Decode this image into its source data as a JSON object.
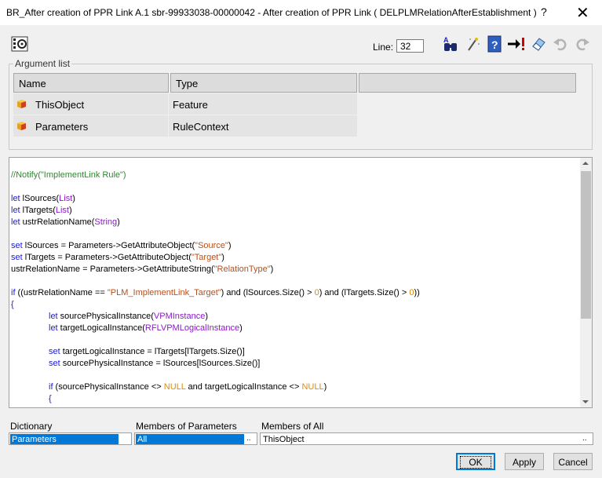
{
  "window": {
    "title": "BR_After creation of PPR Link A.1 sbr-99933038-00000042 - After creation of PPR Link   ( DELPLMRelationAfterEstablishment )",
    "help": "?",
    "close": "✕"
  },
  "toolbar": {
    "line_label": "Line:",
    "line_value": "32"
  },
  "arguments": {
    "group_label": "Argument list",
    "headers": [
      "Name",
      "Type"
    ],
    "rows": [
      {
        "name": "ThisObject",
        "type": "Feature"
      },
      {
        "name": "Parameters",
        "type": "RuleContext"
      }
    ]
  },
  "editor": {
    "lines": [
      {
        "text": "//Notify(\"ImplementLink Rule\")"
      },
      {
        "text": ""
      },
      {
        "text": "let lSources(List)"
      },
      {
        "text": "let lTargets(List)"
      },
      {
        "text": "let ustrRelationName(String)"
      },
      {
        "text": ""
      },
      {
        "text": "set lSources = Parameters->GetAttributeObject(\"Source\")"
      },
      {
        "text": "set lTargets = Parameters->GetAttributeObject(\"Target\")"
      },
      {
        "text": "ustrRelationName = Parameters->GetAttributeString(\"RelationType\")"
      },
      {
        "text": ""
      },
      {
        "text": "if ((ustrRelationName == \"PLM_ImplementLink_Target\") and (lSources.Size() > 0) and (lTargets.Size() > 0))"
      },
      {
        "text": "{"
      },
      {
        "text": "let sourcePhysicalInstance(VPMInstance)"
      },
      {
        "text": "let targetLogicalInstance(RFLVPMLogicalInstance)"
      },
      {
        "text": ""
      },
      {
        "text": "set targetLogicalInstance = lTargets[lTargets.Size()]"
      },
      {
        "text": "set sourcePhysicalInstance = lSources[lSources.Size()]"
      },
      {
        "text": ""
      },
      {
        "text": "if (sourcePhysicalInstance <> NULL and targetLogicalInstance <> NULL)"
      },
      {
        "text": "{"
      }
    ]
  },
  "bottom": {
    "dictionary_label": "Dictionary",
    "dictionary_value": "Parameters",
    "members_params_label": "Members of Parameters",
    "members_params_value": "All",
    "members_all_label": "Members of All",
    "members_all_value": "ThisObject",
    "dots": ".."
  },
  "buttons": {
    "ok": "OK",
    "apply": "Apply",
    "cancel": "Cancel"
  },
  "icons": [
    "film-settings-icon",
    "search-binoculars-icon",
    "magic-wand-icon",
    "help-book-icon",
    "goto-error-icon",
    "eraser-icon",
    "undo-icon",
    "redo-icon",
    "cube-icon"
  ]
}
